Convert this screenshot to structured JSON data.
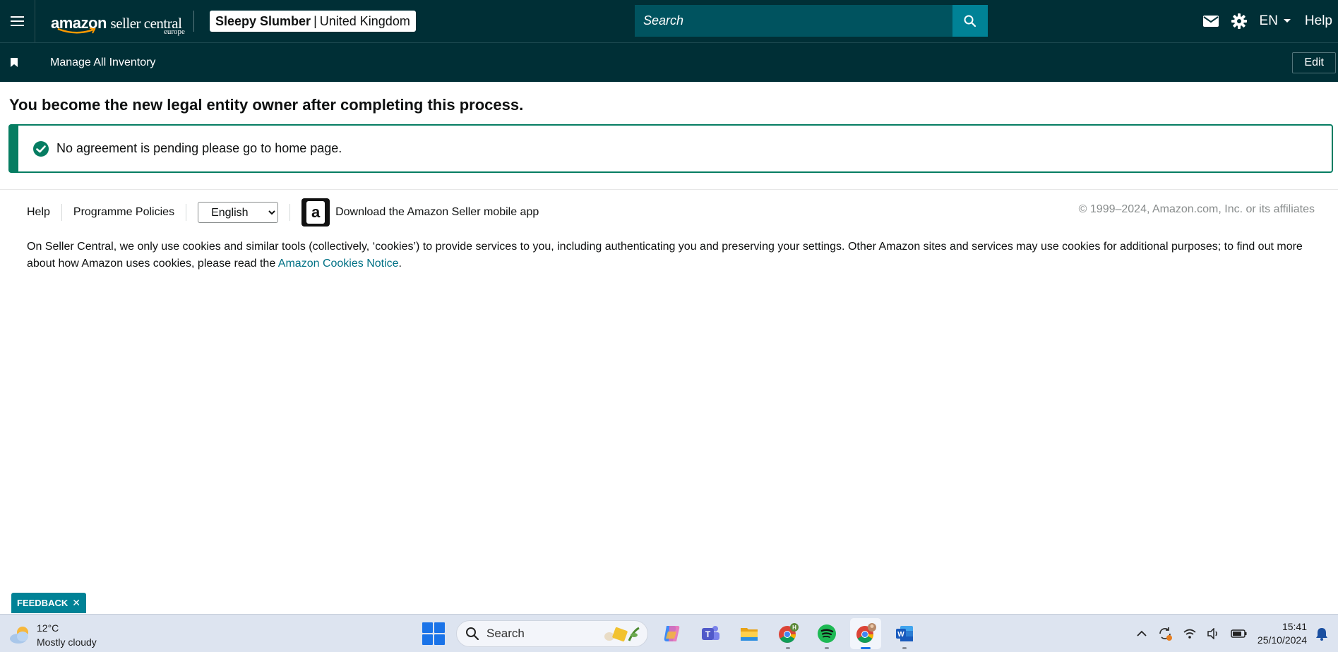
{
  "header": {
    "menu_icon": "hamburger-icon",
    "logo_text_bold": "amazon",
    "logo_text_light": "seller central",
    "logo_region": "europe",
    "store_name": "Sleepy Slumber",
    "store_separator": "|",
    "store_marketplace": "United Kingdom",
    "search_placeholder": "Search",
    "search_icon": "search-icon",
    "mail_icon": "mail-icon",
    "settings_icon": "gear-icon",
    "language": "EN",
    "help": "Help"
  },
  "subnav": {
    "bookmark_icon": "bookmark-icon",
    "item": "Manage All Inventory",
    "edit": "Edit"
  },
  "main": {
    "title": "You become the new legal entity owner after completing this process.",
    "alert_icon": "check-circle-icon",
    "alert_message": "No agreement is pending please go to home page."
  },
  "footer": {
    "help": "Help",
    "policies": "Programme Policies",
    "language_selected": "English",
    "app_link": "Download the Amazon Seller mobile app",
    "copyright": "© 1999–2024, Amazon.com, Inc. or its affiliates",
    "cookie_text_before": "On Seller Central, we only use cookies and similar tools (collectively, ‘cookies’) to provide services to you, including authenticating you and preserving your settings. Other Amazon sites and services may use cookies for additional purposes; to find out more about how Amazon uses cookies, please read the ",
    "cookie_link": "Amazon Cookies Notice",
    "cookie_text_after": "."
  },
  "feedback": {
    "label": "FEEDBACK",
    "close": "✕"
  },
  "taskbar": {
    "temperature": "12°C",
    "weather": "Mostly cloudy",
    "search": "Search",
    "time": "15:41",
    "date": "25/10/2024",
    "colors": {
      "accent": "#1a73e8",
      "bar": "#dde4f0"
    }
  },
  "colors": {
    "nav_bg": "#002f36",
    "search_bg": "#00535f",
    "search_btn": "#008296",
    "success": "#067d62",
    "link": "#007185"
  }
}
